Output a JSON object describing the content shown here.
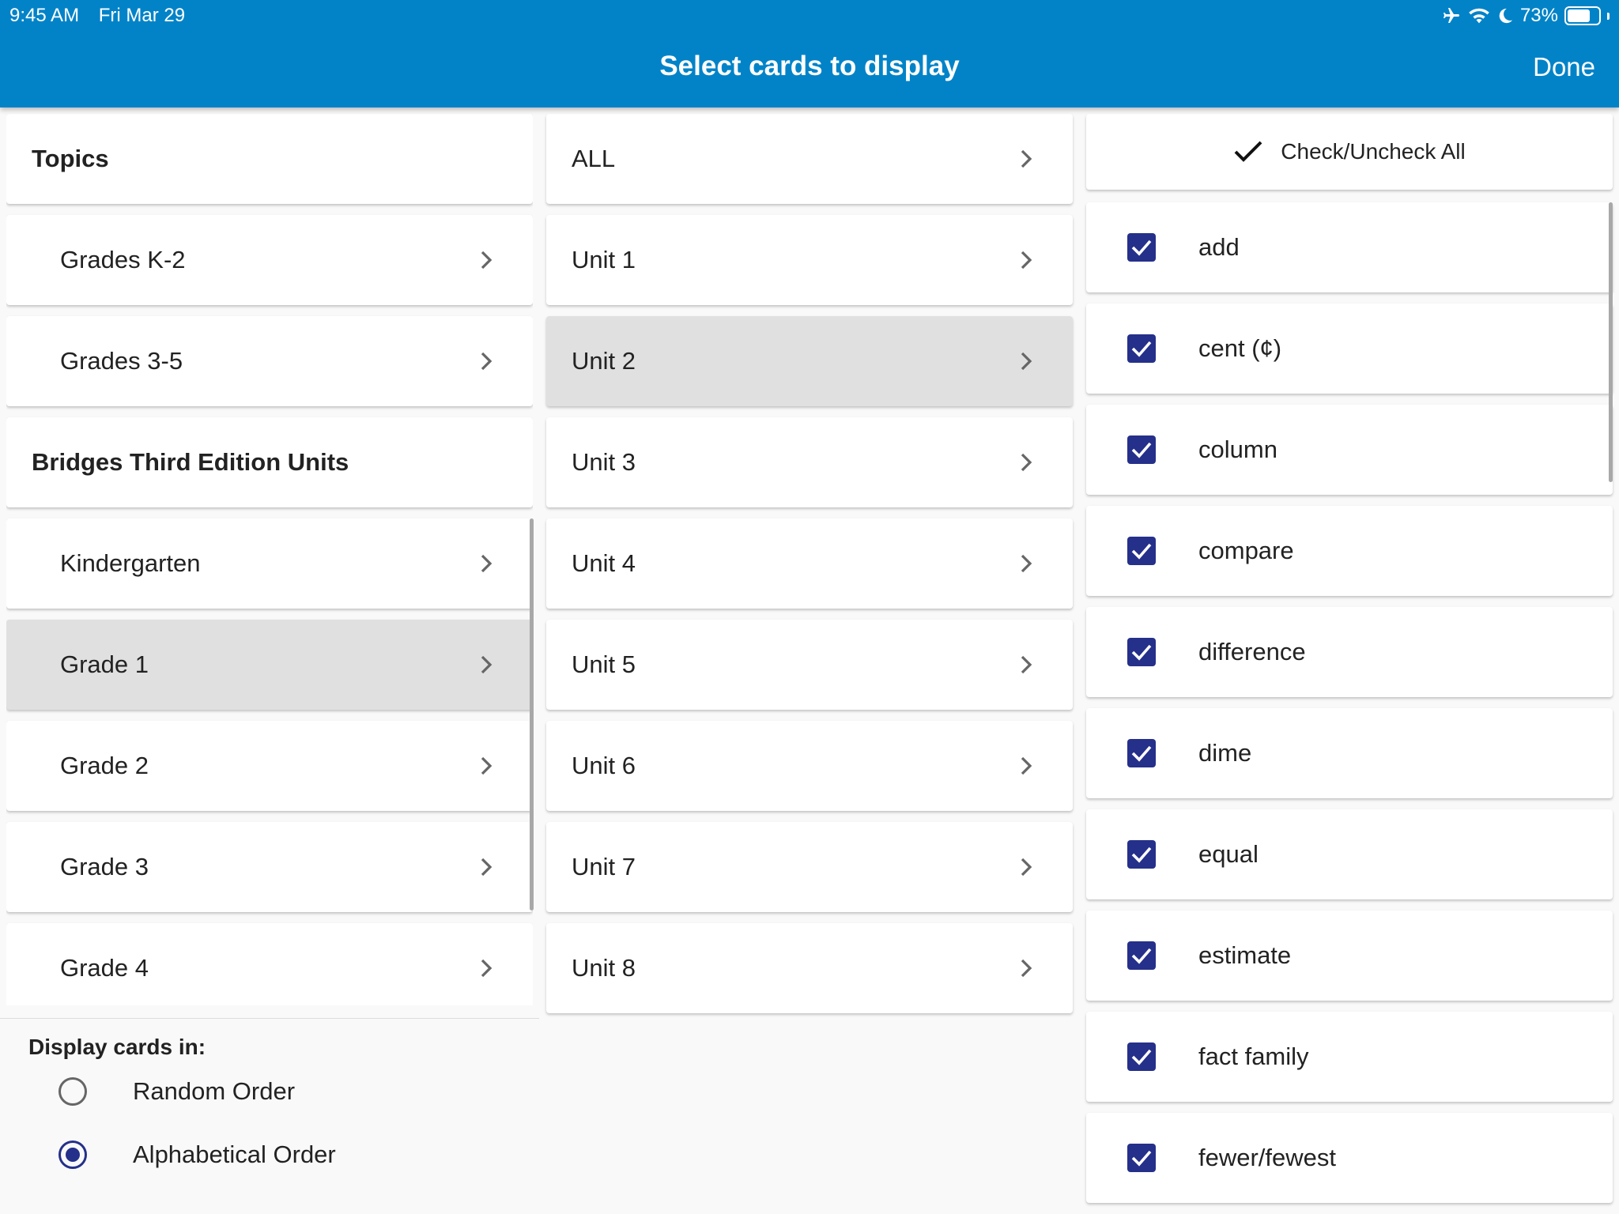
{
  "status": {
    "time": "9:45 AM",
    "date": "Fri Mar 29",
    "battery": "73%",
    "battery_level": 0.73
  },
  "header": {
    "title": "Select cards to display",
    "done": "Done"
  },
  "categories": [
    {
      "label": "Topics",
      "header": true,
      "selected": false
    },
    {
      "label": "Grades K-2",
      "header": false,
      "selected": false
    },
    {
      "label": "Grades 3-5",
      "header": false,
      "selected": false
    },
    {
      "label": "Bridges Third Edition Units",
      "header": true,
      "selected": false
    },
    {
      "label": "Kindergarten",
      "header": false,
      "selected": false
    },
    {
      "label": "Grade 1",
      "header": false,
      "selected": true
    },
    {
      "label": "Grade 2",
      "header": false,
      "selected": false
    },
    {
      "label": "Grade 3",
      "header": false,
      "selected": false
    },
    {
      "label": "Grade 4",
      "header": false,
      "selected": false
    }
  ],
  "units": [
    {
      "label": "ALL",
      "selected": false
    },
    {
      "label": "Unit 1",
      "selected": false
    },
    {
      "label": "Unit 2",
      "selected": true
    },
    {
      "label": "Unit 3",
      "selected": false
    },
    {
      "label": "Unit 4",
      "selected": false
    },
    {
      "label": "Unit 5",
      "selected": false
    },
    {
      "label": "Unit 6",
      "selected": false
    },
    {
      "label": "Unit 7",
      "selected": false
    },
    {
      "label": "Unit 8",
      "selected": false
    }
  ],
  "words": {
    "check_all_label": "Check/Uncheck All",
    "items": [
      {
        "label": "add",
        "checked": true
      },
      {
        "label": "cent (¢)",
        "checked": true
      },
      {
        "label": "column",
        "checked": true
      },
      {
        "label": "compare",
        "checked": true
      },
      {
        "label": "difference",
        "checked": true
      },
      {
        "label": "dime",
        "checked": true
      },
      {
        "label": "equal",
        "checked": true
      },
      {
        "label": "estimate",
        "checked": true
      },
      {
        "label": "fact family",
        "checked": true
      },
      {
        "label": "fewer/fewest",
        "checked": true
      }
    ]
  },
  "display": {
    "label": "Display cards in:",
    "options": [
      {
        "label": "Random Order",
        "selected": false
      },
      {
        "label": "Alphabetical Order",
        "selected": true
      }
    ]
  }
}
